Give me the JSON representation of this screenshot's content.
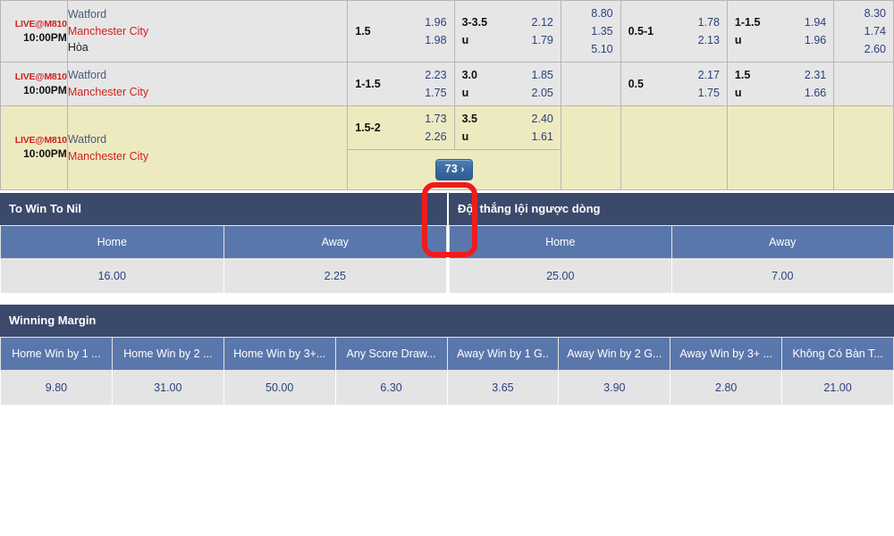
{
  "odds_board": {
    "rows": [
      {
        "time": {
          "live_tag": "LIVE@M810",
          "kickoff": "10:00PM"
        },
        "teams": {
          "home": "Watford",
          "away": "Manchester City",
          "draw": "Hòa"
        },
        "handicap_left": {
          "line": "1.5",
          "odds_top": "1.96",
          "odds_bottom": "1.98"
        },
        "over_under_left": {
          "line_top": "3-3.5",
          "line_bottom": "u",
          "odds_top": "2.12",
          "odds_bottom": "1.79"
        },
        "one_x_two_left": {
          "home": "8.80",
          "draw": "1.35",
          "away": "5.10"
        },
        "handicap_right": {
          "line": "0.5-1",
          "odds_top": "1.78",
          "odds_bottom": "2.13"
        },
        "over_under_right": {
          "line_top": "1-1.5",
          "line_bottom": "u",
          "odds_top": "1.94",
          "odds_bottom": "1.96"
        },
        "one_x_two_right": {
          "home": "8.30",
          "draw": "1.74",
          "away": "2.60"
        }
      },
      {
        "time": {
          "live_tag": "LIVE@M810",
          "kickoff": "10:00PM"
        },
        "teams": {
          "home": "Watford",
          "away": "Manchester City",
          "draw": ""
        },
        "handicap_left": {
          "line": "1-1.5",
          "odds_top": "2.23",
          "odds_bottom": "1.75"
        },
        "over_under_left": {
          "line_top": "3.0",
          "line_bottom": "u",
          "odds_top": "1.85",
          "odds_bottom": "2.05"
        },
        "one_x_two_left": {
          "home": "",
          "draw": "",
          "away": ""
        },
        "handicap_right": {
          "line": "0.5",
          "odds_top": "2.17",
          "odds_bottom": "1.75"
        },
        "over_under_right": {
          "line_top": "1.5",
          "line_bottom": "u",
          "odds_top": "2.31",
          "odds_bottom": "1.66"
        },
        "one_x_two_right": {
          "home": "",
          "draw": "",
          "away": ""
        }
      },
      {
        "time": {
          "live_tag": "LIVE@M810",
          "kickoff": "10:00PM"
        },
        "teams": {
          "home": "Watford",
          "away": "Manchester City",
          "draw": ""
        },
        "handicap_left": {
          "line": "1.5-2",
          "odds_top": "1.73",
          "odds_bottom": "2.26"
        },
        "over_under_left": {
          "line_top": "3.5",
          "line_bottom": "u",
          "odds_top": "2.40",
          "odds_bottom": "1.61"
        },
        "one_x_two_left": {
          "home": "",
          "draw": "",
          "away": ""
        },
        "handicap_right": {
          "line": "",
          "odds_top": "",
          "odds_bottom": ""
        },
        "over_under_right": {
          "line_top": "",
          "line_bottom": "",
          "odds_top": "",
          "odds_bottom": ""
        },
        "one_x_two_right": {
          "home": "",
          "draw": "",
          "away": ""
        }
      }
    ],
    "more_markets_button": {
      "count": "73",
      "chevron": "›"
    }
  },
  "markets": [
    {
      "title": "To Win To Nil",
      "columns": [
        "Home",
        "Away"
      ],
      "values": [
        "16.00",
        "2.25"
      ]
    },
    {
      "title": "Đội thắng lội ngược dòng",
      "columns": [
        "Home",
        "Away"
      ],
      "values": [
        "25.00",
        "7.00"
      ]
    },
    {
      "title": "Winning Margin",
      "columns": [
        "Home Win by 1 ...",
        "Home Win by 2 ...",
        "Home Win by 3+...",
        "Any Score Draw...",
        "Away Win by 1 G..",
        "Away Win by 2 G...",
        "Away Win by 3+ ...",
        "Không Có Bàn T..."
      ],
      "values": [
        "9.80",
        "31.00",
        "50.00",
        "6.30",
        "3.65",
        "3.90",
        "2.80",
        "21.00"
      ]
    }
  ],
  "colors": {
    "header_navy": "#3b4a6b",
    "subheader_blue": "#5a77ab",
    "odds_blue": "#2b3f7d",
    "live_red": "#cf2222",
    "row_highlight": "#eeeac0",
    "annotation_red": "#ee1c1c"
  }
}
